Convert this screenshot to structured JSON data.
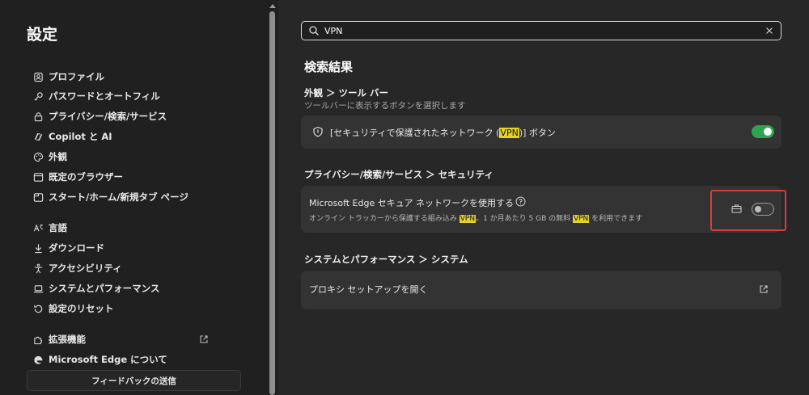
{
  "sidebar": {
    "title": "設定",
    "items": [
      {
        "label": "プロファイル",
        "icon": "profile-icon"
      },
      {
        "label": "パスワードとオートフィル",
        "icon": "key-icon"
      },
      {
        "label": "プライバシー/検索/サービス",
        "icon": "lock-icon"
      },
      {
        "label": "Copilot と AI",
        "icon": "copilot-icon"
      },
      {
        "label": "外観",
        "icon": "palette-icon"
      },
      {
        "label": "既定のブラウザー",
        "icon": "browser-icon"
      },
      {
        "label": "スタート/ホーム/新規タブ ページ",
        "icon": "home-tab-icon"
      },
      {
        "label": "言語",
        "icon": "language-icon"
      },
      {
        "label": "ダウンロード",
        "icon": "download-icon"
      },
      {
        "label": "アクセシビリティ",
        "icon": "accessibility-icon"
      },
      {
        "label": "システムとパフォーマンス",
        "icon": "laptop-icon"
      },
      {
        "label": "設定のリセット",
        "icon": "reset-icon"
      },
      {
        "label": "拡張機能",
        "icon": "puzzle-icon"
      },
      {
        "label": "Microsoft Edge について",
        "icon": "edge-icon"
      }
    ],
    "feedback_label": "フィードバックの送信"
  },
  "search": {
    "value": "VPN"
  },
  "results": {
    "heading": "検索結果",
    "sections": [
      {
        "title": "外観 ＞ ツール バー",
        "subtitle": "ツールバーに表示するボタンを選択します",
        "card": {
          "pre": "[セキュリティで保護されたネットワーク (",
          "highlight": "VPN",
          "post": ")] ボタン",
          "toggle": "on"
        }
      },
      {
        "title": "プライバシー/検索/サービス ＞ セキュリティ",
        "card": {
          "label": "Microsoft Edge セキュア ネットワークを使用する",
          "desc_pre": "オンライン トラッカーから保護する組み込み ",
          "desc_hl1": "VPN",
          "desc_mid": "。1 か月あたり 5 GB の無料 ",
          "desc_hl2": "VPN",
          "desc_post": " を利用できます",
          "toggle": "off"
        }
      },
      {
        "title": "システムとパフォーマンス ＞ システム",
        "card": {
          "label": "プロキシ セットアップを開く"
        }
      }
    ]
  },
  "colors": {
    "toggle_on": "#2ea44f",
    "highlight": "#e5d32a",
    "annotation_box": "#e03a3a"
  }
}
